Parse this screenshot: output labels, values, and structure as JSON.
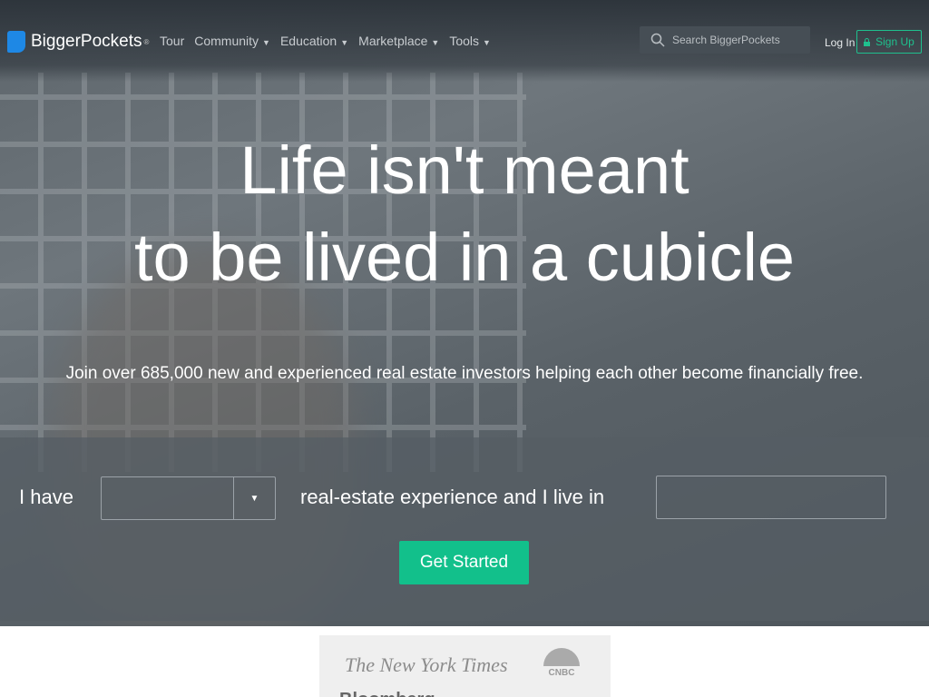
{
  "nav": {
    "brand": "BiggerPockets",
    "registered": "®",
    "items": [
      {
        "label": "Tour",
        "dropdown": false
      },
      {
        "label": "Community",
        "dropdown": true
      },
      {
        "label": "Education",
        "dropdown": true
      },
      {
        "label": "Marketplace",
        "dropdown": true
      },
      {
        "label": "Tools",
        "dropdown": true
      }
    ],
    "search_placeholder": "Search BiggerPockets",
    "login": "Log In",
    "signup": "Sign Up",
    "accent": "#1fc08e"
  },
  "hero": {
    "title_line1": "Life isn't meant",
    "title_line2": "to be lived in a cubicle",
    "subtitle": "Join over 685,000 new and experienced real estate investors helping each other become financially free."
  },
  "form": {
    "label_1": "I have",
    "experience_value": "",
    "label_2": "real-estate experience and I live in",
    "location_value": "",
    "submit": "Get Started",
    "button_color": "#12c08b"
  },
  "press": {
    "logos": [
      "The New York Times",
      "CNBC",
      "Bloomberg"
    ]
  }
}
